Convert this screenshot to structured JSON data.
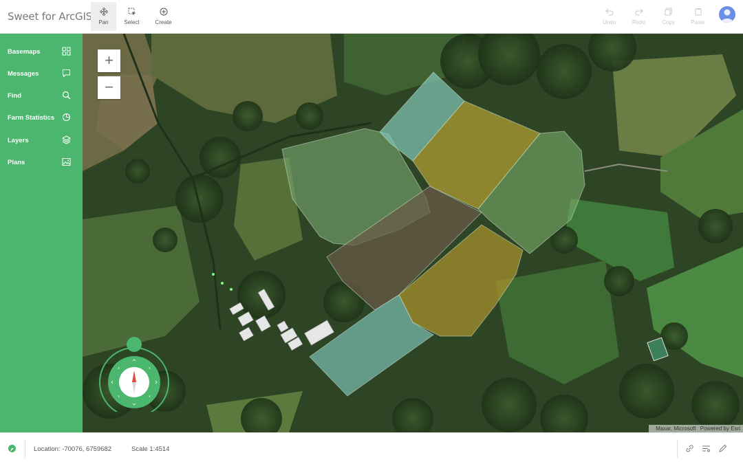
{
  "app": {
    "title": "Sweet for ArcGIS"
  },
  "toolbar": {
    "tools": [
      {
        "label": "Pan",
        "icon": "move-icon",
        "active": true
      },
      {
        "label": "Select",
        "icon": "select-icon"
      },
      {
        "label": "Create",
        "icon": "plus-circle-icon"
      }
    ],
    "edit_actions": [
      {
        "label": "Undo",
        "icon": "undo-icon",
        "enabled": false
      },
      {
        "label": "Redo",
        "icon": "redo-icon",
        "enabled": false
      },
      {
        "label": "Copy",
        "icon": "copy-icon",
        "enabled": false
      },
      {
        "label": "Paste",
        "icon": "paste-icon",
        "enabled": false
      }
    ],
    "user_icon": "user-avatar-icon"
  },
  "sidebar": {
    "items": [
      {
        "label": "Basemaps",
        "icon": "grid-icon"
      },
      {
        "label": "Messages",
        "icon": "message-icon"
      },
      {
        "label": "Find",
        "icon": "search-icon"
      },
      {
        "label": "Farm Statistics",
        "icon": "pie-chart-icon"
      },
      {
        "label": "Layers",
        "icon": "layers-icon"
      },
      {
        "label": "Plans",
        "icon": "image-icon"
      }
    ]
  },
  "map": {
    "zoom_in": "+",
    "zoom_out": "−",
    "attribution": {
      "source": "Maxar, Microsoft",
      "powered_by": "Powered by Esri"
    },
    "compass_icon": "compass-icon"
  },
  "status_bar": {
    "location": "Location: -70076, 6759682",
    "scale": "Scale 1:4514",
    "icons": [
      "link-icon",
      "filter-list-icon",
      "pencil-icon"
    ]
  },
  "colors": {
    "sidebar": "#4ab66e",
    "parcel_teal": "#7cc8b4",
    "parcel_gold": "#a89a2e",
    "parcel_green": "#6fa36a",
    "parcel_brown": "#6b5a48"
  }
}
